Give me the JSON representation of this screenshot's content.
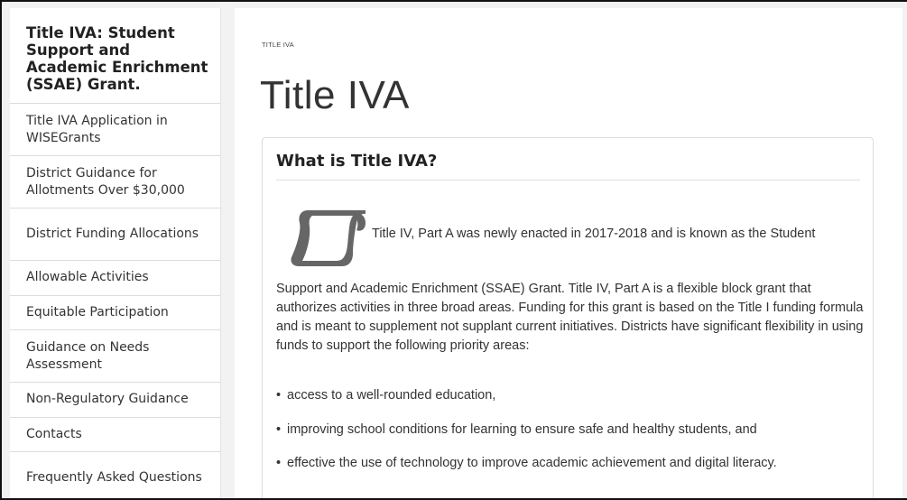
{
  "sidebar": {
    "title": "Title IVA: Student Support and Academic Enrichment (SSAE) Grant.",
    "items": [
      {
        "label": "Title IVA Application in WISEGrants"
      },
      {
        "label": "District Guidance for Allotments Over $30,000"
      },
      {
        "label": "District Funding Allocations"
      },
      {
        "label": "Allowable Activities"
      },
      {
        "label": "Equitable Participation"
      },
      {
        "label": "Guidance on Needs Assessment"
      },
      {
        "label": "Non-Regulatory Guidance"
      },
      {
        "label": "Contacts"
      },
      {
        "label": "Frequently Asked Questions"
      }
    ]
  },
  "main": {
    "breadcrumb": "TITLE IVA",
    "title": "Title IVA",
    "card": {
      "heading": "What is Title IVA?",
      "icon": "scroll-icon",
      "intro": "Title IV, Part A was newly enacted in 2017-2018 and is known as the Student",
      "paragraph": "Support and Academic Enrichment (SSAE) Grant. Title IV, Part A is a flexible block grant that authorizes activities in three broad areas. Funding for this grant is based on the Title I funding formula and is meant to supplement not supplant current initiatives.  Districts have significant flexibility in using funds to support the following priority areas:",
      "bullets": [
        "access to a well-rounded education,",
        "improving school conditions for learning to ensure safe and healthy students, and",
        "effective the use of technology to improve academic achievement and digital literacy."
      ]
    }
  },
  "colors": {
    "icon": "#666666",
    "text": "#333333",
    "border": "#dcdcdc",
    "background": "#f2f2f2"
  }
}
